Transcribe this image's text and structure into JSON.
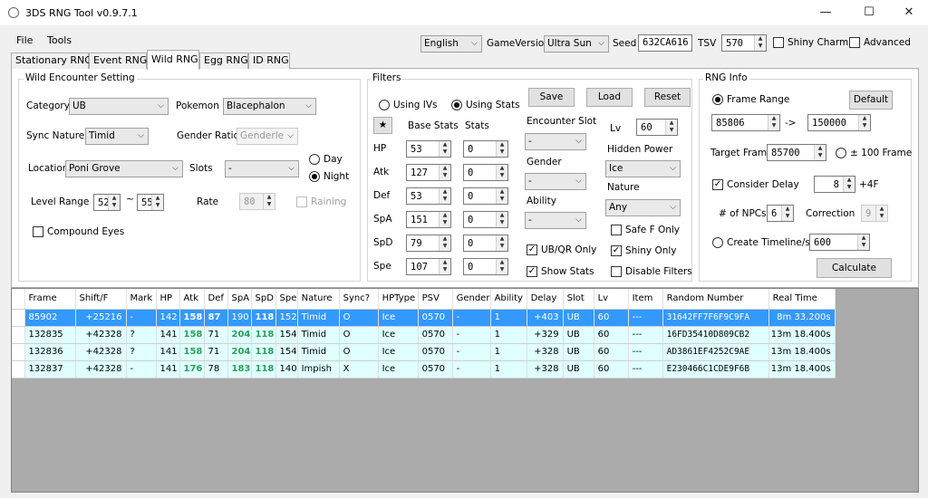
{
  "window": {
    "title": "3DS RNG Tool v0.9.7.1",
    "minimize": "—",
    "maximize": "☐",
    "close": "✕"
  },
  "menu": [
    "File",
    "Tools"
  ],
  "top": {
    "language": "English",
    "game_version_label": "GameVersion",
    "game_version": "Ultra Sun",
    "seed_label": "Seed",
    "seed": "632CA616",
    "tsv_label": "TSV",
    "tsv": "570",
    "shiny_charm_label": "Shiny Charm",
    "advanced_label": "Advanced"
  },
  "tabs": [
    "Stationary RNG",
    "Event RNG",
    "Wild RNG",
    "Egg RNG",
    "ID RNG"
  ],
  "wild": {
    "legend": "Wild Encounter Setting",
    "category_label": "Category",
    "category": "UB",
    "pokemon_label": "Pokemon",
    "pokemon": "Blacephalon",
    "sync_label": "Sync Nature",
    "sync": "Timid",
    "gender_ratio_label": "Gender Ratio",
    "gender_ratio": "Genderles:",
    "day_label": "Day",
    "night_label": "Night",
    "location_label": "Location",
    "location": "Poni Grove",
    "slots_label": "Slots",
    "slots": "-",
    "level_label": "Level Range",
    "level_min": "52",
    "level_tilde": "~",
    "level_max": "55",
    "rate_label": "Rate",
    "rate": "80",
    "raining_label": "Raining",
    "compound_label": "Compound Eyes"
  },
  "filters": {
    "legend": "Filters",
    "using_ivs": "Using IVs",
    "using_stats": "Using Stats",
    "save": "Save",
    "load": "Load",
    "reset": "Reset",
    "star": "★",
    "base_stats": "Base Stats",
    "stats": "Stats",
    "rows": [
      {
        "name": "HP",
        "base": "53",
        "stat": "0"
      },
      {
        "name": "Atk",
        "base": "127",
        "stat": "0"
      },
      {
        "name": "Def",
        "base": "53",
        "stat": "0"
      },
      {
        "name": "SpA",
        "base": "151",
        "stat": "0"
      },
      {
        "name": "SpD",
        "base": "79",
        "stat": "0"
      },
      {
        "name": "Spe",
        "base": "107",
        "stat": "0"
      }
    ],
    "encounter_slot_label": "Encounter Slot",
    "encounter_slot": "-",
    "gender_label": "Gender",
    "gender": "-",
    "ability_label": "Ability",
    "ability": "-",
    "lv_label": "Lv",
    "lv": "60",
    "hidden_power_label": "Hidden Power",
    "hidden_power": "Ice",
    "nature_label": "Nature",
    "nature": "Any",
    "safe_f_label": "Safe F Only",
    "ubqr_label": "UB/QR Only",
    "shiny_only_label": "Shiny Only",
    "show_stats_label": "Show Stats",
    "disable_filters_label": "Disable Filters",
    "check": "✓"
  },
  "rng": {
    "legend": "RNG Info",
    "frame_range_label": "Frame Range",
    "default": "Default",
    "frame_min": "85806",
    "arrow": "->",
    "frame_max": "150000",
    "target_label": "Target Frame",
    "target": "85700",
    "pm100_label": "± 100 Frame",
    "consider_delay_label": "Consider Delay",
    "delay": "8",
    "plus4f": "+4F",
    "npcs_label": "# of NPCs",
    "npcs": "6",
    "correction_label": "Correction",
    "correction": "9",
    "timeline_label": "Create Timeline/s",
    "timeline": "600",
    "calculate": "Calculate"
  },
  "results": {
    "columns": [
      "Frame",
      "Shift/F",
      "Mark",
      "HP",
      "Atk",
      "Def",
      "SpA",
      "SpD",
      "Spe",
      "Nature",
      "Sync?",
      "HPType",
      "PSV",
      "Gender",
      "Ability",
      "Delay",
      "Slot",
      "Lv",
      "Item",
      "Random Number",
      "Real Time"
    ],
    "rows": [
      [
        "85902",
        "+25216",
        "-",
        "142",
        "158",
        "87",
        "190",
        "118",
        "152",
        "Timid",
        "O",
        "Ice",
        "0570",
        "-",
        "1",
        "+403",
        "UB",
        "60",
        "---",
        "31642FF7F6F9C9FA",
        "8m 33.200s"
      ],
      [
        "132835",
        "+42328",
        "?",
        "141",
        "158",
        "71",
        "204",
        "118",
        "154",
        "Timid",
        "O",
        "Ice",
        "0570",
        "-",
        "1",
        "+329",
        "UB",
        "60",
        "---",
        "16FD35410D809CB2",
        "13m 18.400s"
      ],
      [
        "132836",
        "+42328",
        "?",
        "141",
        "158",
        "71",
        "204",
        "118",
        "154",
        "Timid",
        "O",
        "Ice",
        "0570",
        "-",
        "1",
        "+328",
        "UB",
        "60",
        "---",
        "AD3861EF4252C9AE",
        "13m 18.400s"
      ],
      [
        "132837",
        "+42328",
        "-",
        "141",
        "176",
        "78",
        "183",
        "118",
        "140",
        "Impish",
        "X",
        "Ice",
        "0570",
        "-",
        "1",
        "+328",
        "UB",
        "60",
        "---",
        "E230466C1CDE9F6B",
        "13m 18.400s"
      ]
    ],
    "highlight_color": "#2aa15a",
    "selected_color": "#3399ff",
    "row_color": "#e0ffff"
  }
}
